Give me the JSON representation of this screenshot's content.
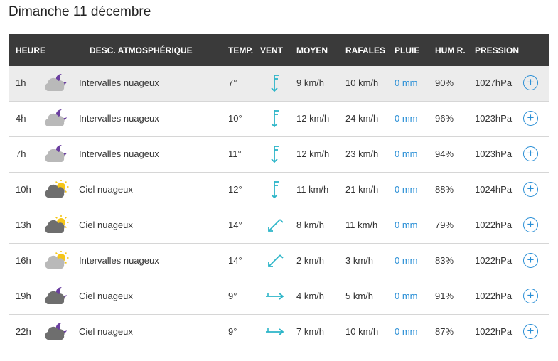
{
  "page": {
    "title": "Dimanche 11 décembre"
  },
  "colors": {
    "header_bg": "#3a3a3a",
    "accent": "#2a8fd6",
    "wind": "#2cb5c8",
    "sun": "#f5c518",
    "moon": "#6b3fa0"
  },
  "table": {
    "headers": {
      "heure": "HEURE",
      "desc": "DESC. ATMOSPHÉRIQUE",
      "temp": "TEMP.",
      "vent": "VENT",
      "moyen": "MOYEN",
      "rafales": "RAFALES",
      "pluie": "PLUIE",
      "hum": "HUM R.",
      "pression": "PRESSION"
    },
    "rows": [
      {
        "hour": "1h",
        "icon": "cloud-moon-icon",
        "desc": "Intervalles nuageux",
        "temp": "7°",
        "wind_dir": "N",
        "wind_icon": "wind-arrow-n-icon",
        "moyen": "9 km/h",
        "rafales": "10 km/h",
        "pluie": "0 mm",
        "hum": "90%",
        "pression": "1027hPa"
      },
      {
        "hour": "4h",
        "icon": "cloud-moon-icon",
        "desc": "Intervalles nuageux",
        "temp": "10°",
        "wind_dir": "N",
        "wind_icon": "wind-arrow-n-icon",
        "moyen": "12 km/h",
        "rafales": "24 km/h",
        "pluie": "0 mm",
        "hum": "96%",
        "pression": "1023hPa"
      },
      {
        "hour": "7h",
        "icon": "cloud-moon-icon",
        "desc": "Intervalles nuageux",
        "temp": "11°",
        "wind_dir": "N",
        "wind_icon": "wind-arrow-n-icon",
        "moyen": "12 km/h",
        "rafales": "23 km/h",
        "pluie": "0 mm",
        "hum": "94%",
        "pression": "1023hPa"
      },
      {
        "hour": "10h",
        "icon": "cloud-sun-dark-icon",
        "desc": "Ciel nuageux",
        "temp": "12°",
        "wind_dir": "N",
        "wind_icon": "wind-arrow-n-icon",
        "moyen": "11 km/h",
        "rafales": "21 km/h",
        "pluie": "0 mm",
        "hum": "88%",
        "pression": "1024hPa"
      },
      {
        "hour": "13h",
        "icon": "cloud-sun-dark-icon",
        "desc": "Ciel nuageux",
        "temp": "14°",
        "wind_dir": "NE",
        "wind_icon": "wind-arrow-ne-icon",
        "moyen": "8 km/h",
        "rafales": "11 km/h",
        "pluie": "0 mm",
        "hum": "79%",
        "pression": "1022hPa"
      },
      {
        "hour": "16h",
        "icon": "cloud-sun-light-icon",
        "desc": "Intervalles nuageux",
        "temp": "14°",
        "wind_dir": "NE",
        "wind_icon": "wind-arrow-ne-icon",
        "moyen": "2 km/h",
        "rafales": "3 km/h",
        "pluie": "0 mm",
        "hum": "83%",
        "pression": "1022hPa"
      },
      {
        "hour": "19h",
        "icon": "cloud-moon-dark-icon",
        "desc": "Ciel nuageux",
        "temp": "9°",
        "wind_dir": "W",
        "wind_icon": "wind-arrow-w-icon",
        "moyen": "4 km/h",
        "rafales": "5 km/h",
        "pluie": "0 mm",
        "hum": "91%",
        "pression": "1022hPa"
      },
      {
        "hour": "22h",
        "icon": "cloud-moon-dark-icon",
        "desc": "Ciel nuageux",
        "temp": "9°",
        "wind_dir": "W",
        "wind_icon": "wind-arrow-w-icon",
        "moyen": "7 km/h",
        "rafales": "10 km/h",
        "pluie": "0 mm",
        "hum": "87%",
        "pression": "1022hPa"
      }
    ],
    "plus_label": "+"
  }
}
